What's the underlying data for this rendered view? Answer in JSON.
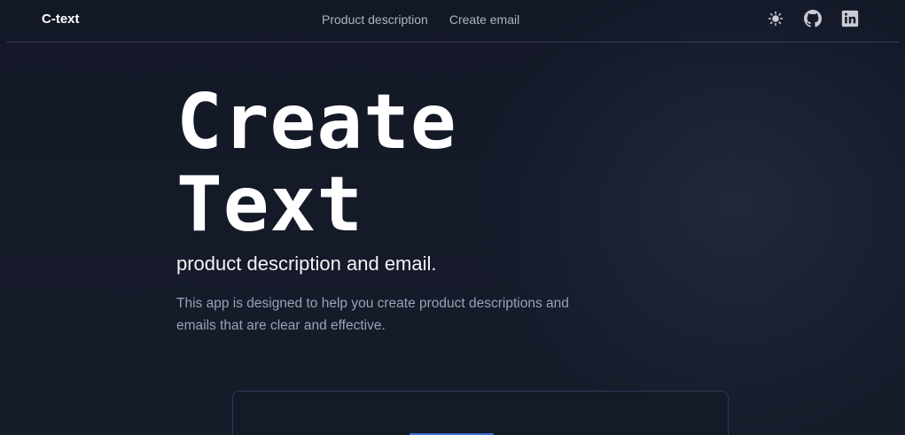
{
  "header": {
    "brand": "C-text",
    "nav": [
      {
        "label": "Product description"
      },
      {
        "label": "Create email"
      }
    ],
    "icons": [
      "sun-icon",
      "github-icon",
      "linkedin-icon"
    ]
  },
  "hero": {
    "title_line1": "Create",
    "title_line2": "Text",
    "subtitle": "product description and email.",
    "description": "This app is designed to help you create product descriptions and emails that are clear and effective."
  },
  "colors": {
    "background": "#151a28",
    "text_primary": "#ffffff",
    "text_muted": "#9aa1b1",
    "accent": "#3b6fd4"
  }
}
